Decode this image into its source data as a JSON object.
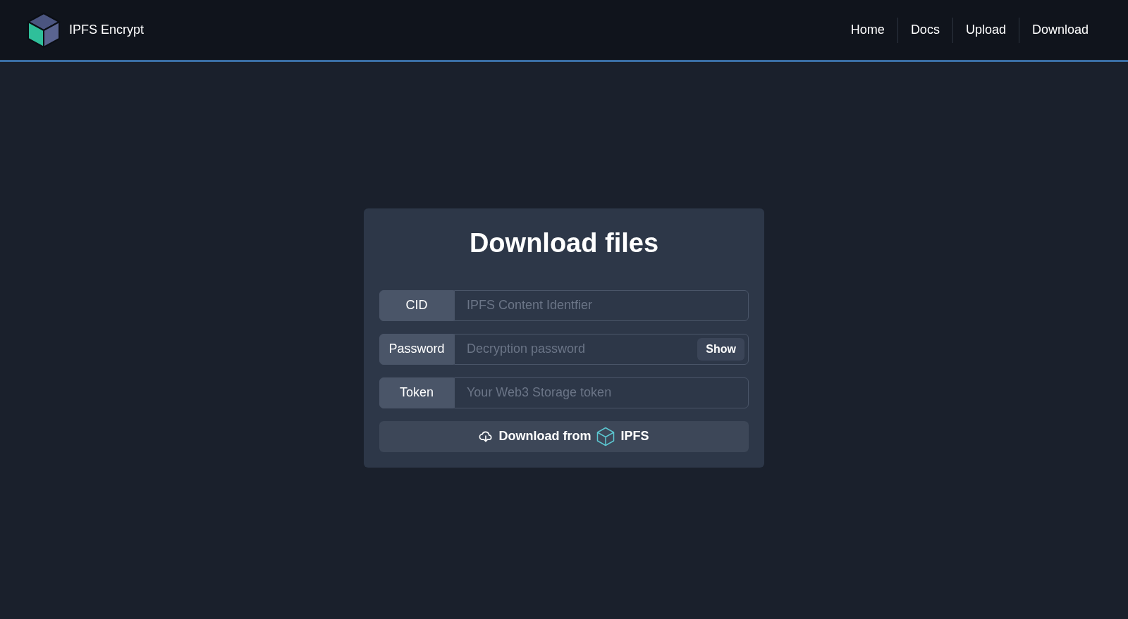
{
  "brand": {
    "name": "IPFS Encrypt"
  },
  "nav": [
    "Home",
    "Docs",
    "Upload",
    "Download"
  ],
  "card": {
    "title": "Download files",
    "fields": [
      {
        "kind": "plain",
        "label": "CID",
        "placeholder": "IPFS Content Identfier"
      },
      {
        "kind": "password",
        "label": "Password",
        "placeholder": "Decryption password",
        "action": "Show"
      },
      {
        "kind": "plain",
        "label": "Token",
        "placeholder": "Your Web3 Storage token"
      }
    ],
    "button": {
      "text": "Download from",
      "suffix": "IPFS"
    }
  }
}
